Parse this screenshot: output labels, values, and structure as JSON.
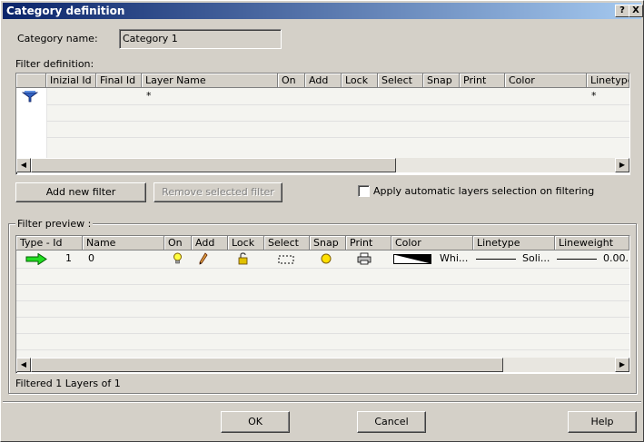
{
  "window": {
    "title": "Category definition",
    "help_btn": "?",
    "close_btn": "X"
  },
  "category": {
    "label": "Category name:",
    "value": "Category 1"
  },
  "filter_definition": {
    "label": "Filter definition:",
    "columns": [
      "Inizial Id",
      "Final Id",
      "Layer Name",
      "On",
      "Add",
      "Lock",
      "Select",
      "Snap",
      "Print",
      "Color",
      "Linetype"
    ],
    "row": {
      "layer_name": "*",
      "linetype": "*"
    }
  },
  "buttons": {
    "add_filter": "Add new filter",
    "remove_filter": "Remove selected filter",
    "ok": "OK",
    "cancel": "Cancel",
    "help": "Help"
  },
  "auto_select": {
    "label": "Apply automatic layers selection on filtering",
    "checked": false
  },
  "filter_preview": {
    "label": "Filter preview :",
    "columns": [
      "Type - Id",
      "Name",
      "On",
      "Add",
      "Lock",
      "Select",
      "Snap",
      "Print",
      "Color",
      "Linetype",
      "Lineweight"
    ],
    "row": {
      "id": "1",
      "name": "0",
      "color": "Whi...",
      "linetype": "Soli...",
      "lineweight": "0.00..."
    }
  },
  "status": "Filtered 1 Layers of 1"
}
